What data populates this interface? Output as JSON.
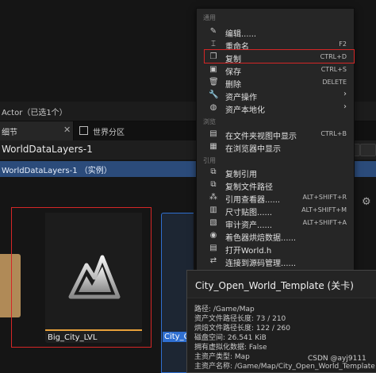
{
  "actor_bar": {
    "label": "Actor（已选1个）"
  },
  "tabs": {
    "details": "细节",
    "close": "✕",
    "world_partition": "世界分区"
  },
  "rows": {
    "world_data_layers": "WorldDataLayers-1",
    "world_data_layers_instance": "WorldDataLayers-1 （实例）"
  },
  "assets": {
    "big_city_name": "Big_City_LVL",
    "city_open_name": "City_Op"
  },
  "menu": {
    "sections": {
      "common": "通用",
      "browse": "浏览",
      "references": "引用"
    },
    "items": [
      {
        "label": "编辑......",
        "shortcut": "",
        "icon": "pencil-icon"
      },
      {
        "label": "重命名",
        "shortcut": "F2",
        "icon": "rename-icon"
      },
      {
        "label": "复制",
        "shortcut": "CTRL+D",
        "icon": "duplicate-icon"
      },
      {
        "label": "保存",
        "shortcut": "CTRL+S",
        "icon": "save-icon"
      },
      {
        "label": "删除",
        "shortcut": "DELETE",
        "icon": "trash-icon"
      },
      {
        "label": "资产操作",
        "shortcut": "",
        "icon": "wrench-icon",
        "submenu": true
      },
      {
        "label": "资产本地化",
        "shortcut": "",
        "icon": "globe-icon",
        "submenu": true
      },
      {
        "label": "在文件夹视图中显示",
        "shortcut": "CTRL+B",
        "icon": "folder-view-icon"
      },
      {
        "label": "在浏览器中显示",
        "shortcut": "",
        "icon": "explorer-icon"
      },
      {
        "label": "复制引用",
        "shortcut": "",
        "icon": "copy-ref-icon"
      },
      {
        "label": "复制文件路径",
        "shortcut": "",
        "icon": "copy-path-icon"
      },
      {
        "label": "引用查看器......",
        "shortcut": "ALT+SHIFT+R",
        "icon": "reference-viewer-icon"
      },
      {
        "label": "尺寸贴图......",
        "shortcut": "ALT+SHIFT+M",
        "icon": "size-map-icon"
      },
      {
        "label": "审计资产......",
        "shortcut": "ALT+SHIFT+A",
        "icon": "audit-icon"
      },
      {
        "label": "着色器烘焙数据......",
        "shortcut": "",
        "icon": "shader-icon"
      },
      {
        "label": "打开World.h",
        "shortcut": "",
        "icon": "header-file-icon"
      },
      {
        "label": "连接到源码管理......",
        "shortcut": "",
        "icon": "source-control-icon"
      }
    ]
  },
  "tooltip": {
    "title": "City_Open_World_Template (关卡)",
    "lines": [
      "路径: /Game/Map",
      "资产文件路径长度: 73 / 210",
      "烘焙文件路径长度: 122 / 260",
      "磁盘空间: 26.541 KiB",
      "拥有虚拟化数据: False",
      "主资产类型: Map",
      "主资产名称: /Game/Map/City_Open_World_Template"
    ]
  },
  "watermark": "CSDN @ayj9111",
  "colors": {
    "accent_red": "#d42626",
    "selection_blue": "#2f6fd1",
    "asset_bar": "#e8a13a"
  }
}
